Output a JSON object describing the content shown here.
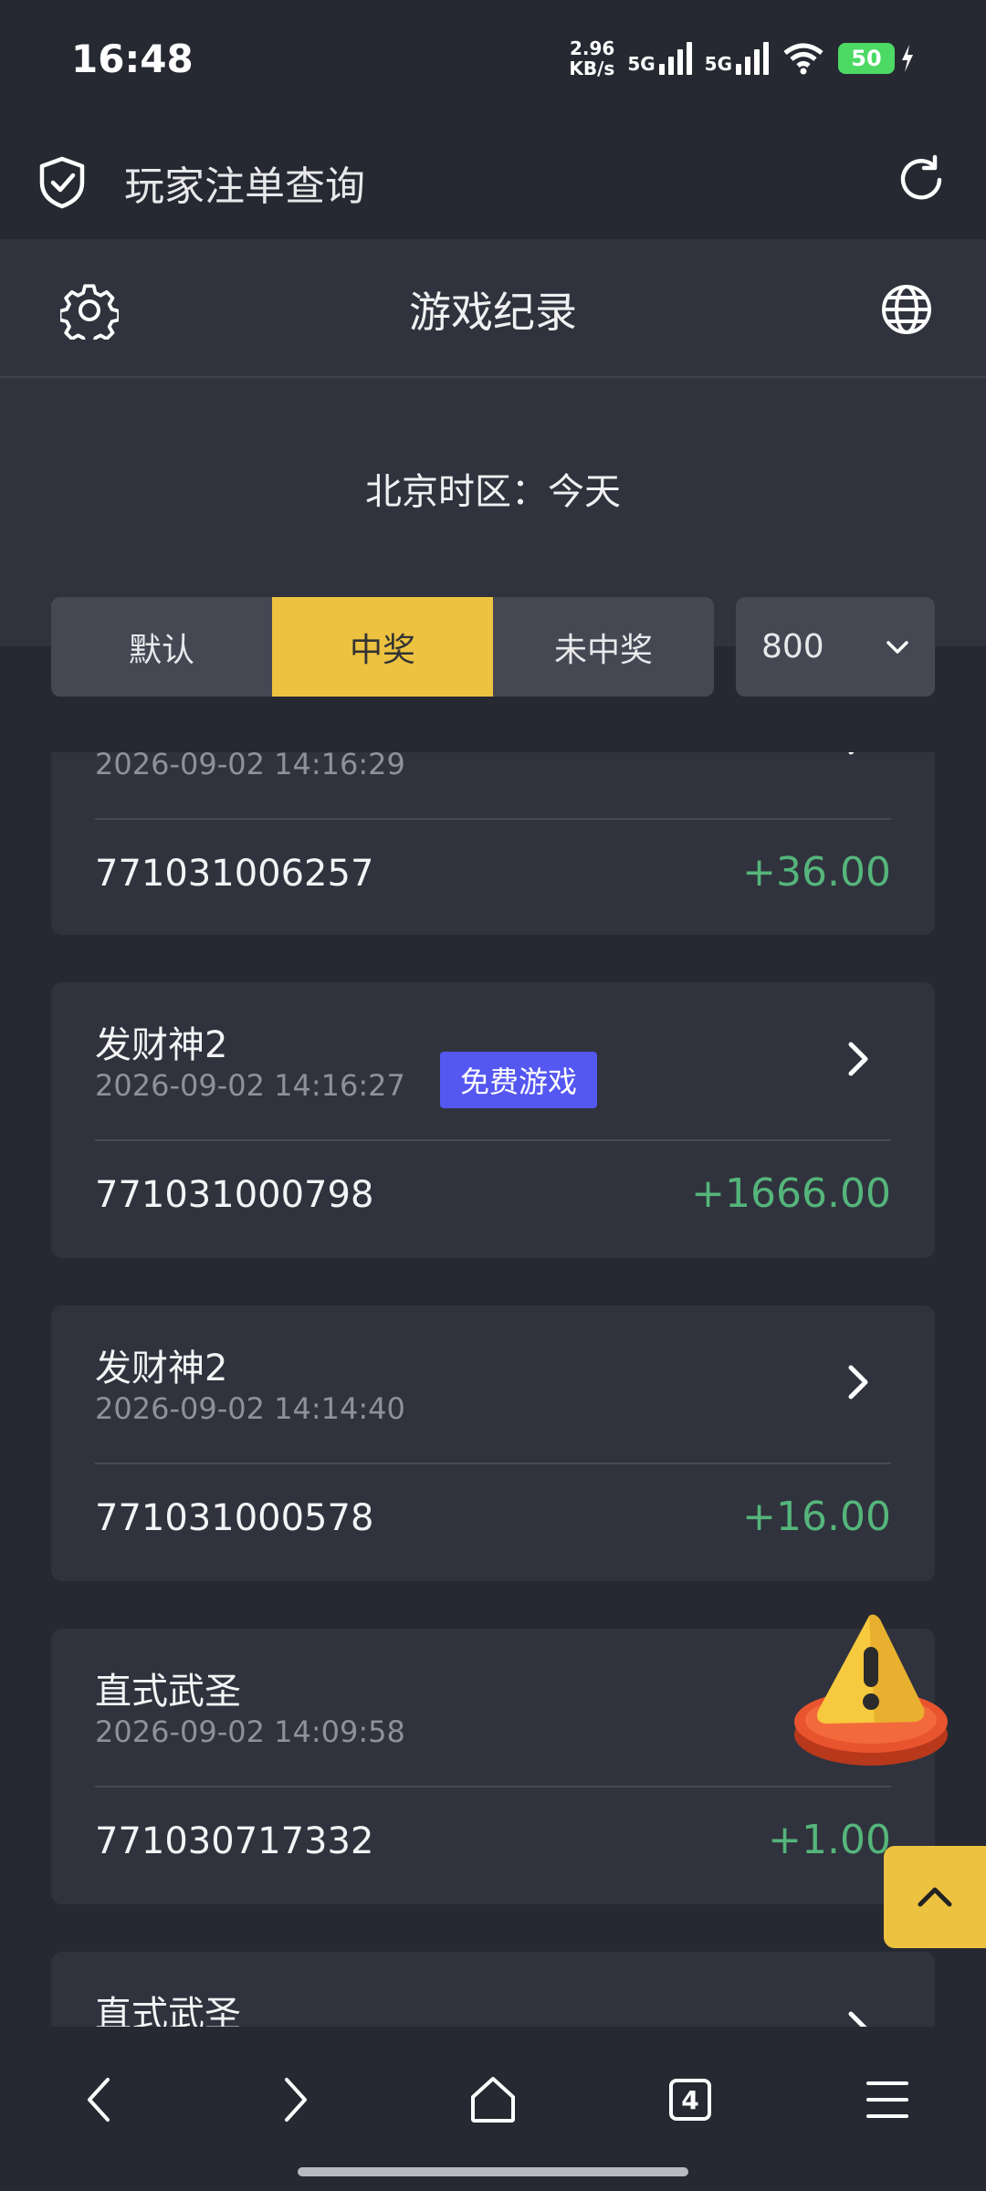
{
  "status_bar": {
    "time": "16:48",
    "net_speed_value": "2.96",
    "net_speed_unit": "KB/s",
    "sim1_label": "5G",
    "sim2_label": "5G",
    "battery": "50"
  },
  "header": {
    "title": "玩家注单查询"
  },
  "nav": {
    "title": "游戏纪录"
  },
  "timezone": {
    "label": "北京时区：今天"
  },
  "filters": {
    "tabs": [
      {
        "label": "默认",
        "active": false
      },
      {
        "label": "中奖",
        "active": true
      },
      {
        "label": "未中奖",
        "active": false
      }
    ],
    "page_size": "800"
  },
  "records": [
    {
      "name": "",
      "time": "2026-09-02 14:16:29",
      "order_no": "771031006257",
      "amount": "+36.00",
      "badge": ""
    },
    {
      "name": "发财神2",
      "time": "2026-09-02 14:16:27",
      "order_no": "771031000798",
      "amount": "+1666.00",
      "badge": "免费游戏"
    },
    {
      "name": "发财神2",
      "time": "2026-09-02 14:14:40",
      "order_no": "771031000578",
      "amount": "+16.00",
      "badge": ""
    },
    {
      "name": "直式武圣",
      "time": "2026-09-02 14:09:58",
      "order_no": "771030717332",
      "amount": "+1.00",
      "badge": ""
    },
    {
      "name": "直式武圣",
      "time": "",
      "order_no": "",
      "amount": "",
      "badge": ""
    }
  ],
  "browser_nav": {
    "tab_count": "4"
  },
  "colors": {
    "accent_yellow": "#ecc240",
    "win_green": "#55b57b",
    "badge_blue": "#5457f0",
    "card_bg": "#30333d",
    "page_bg": "#262931"
  }
}
